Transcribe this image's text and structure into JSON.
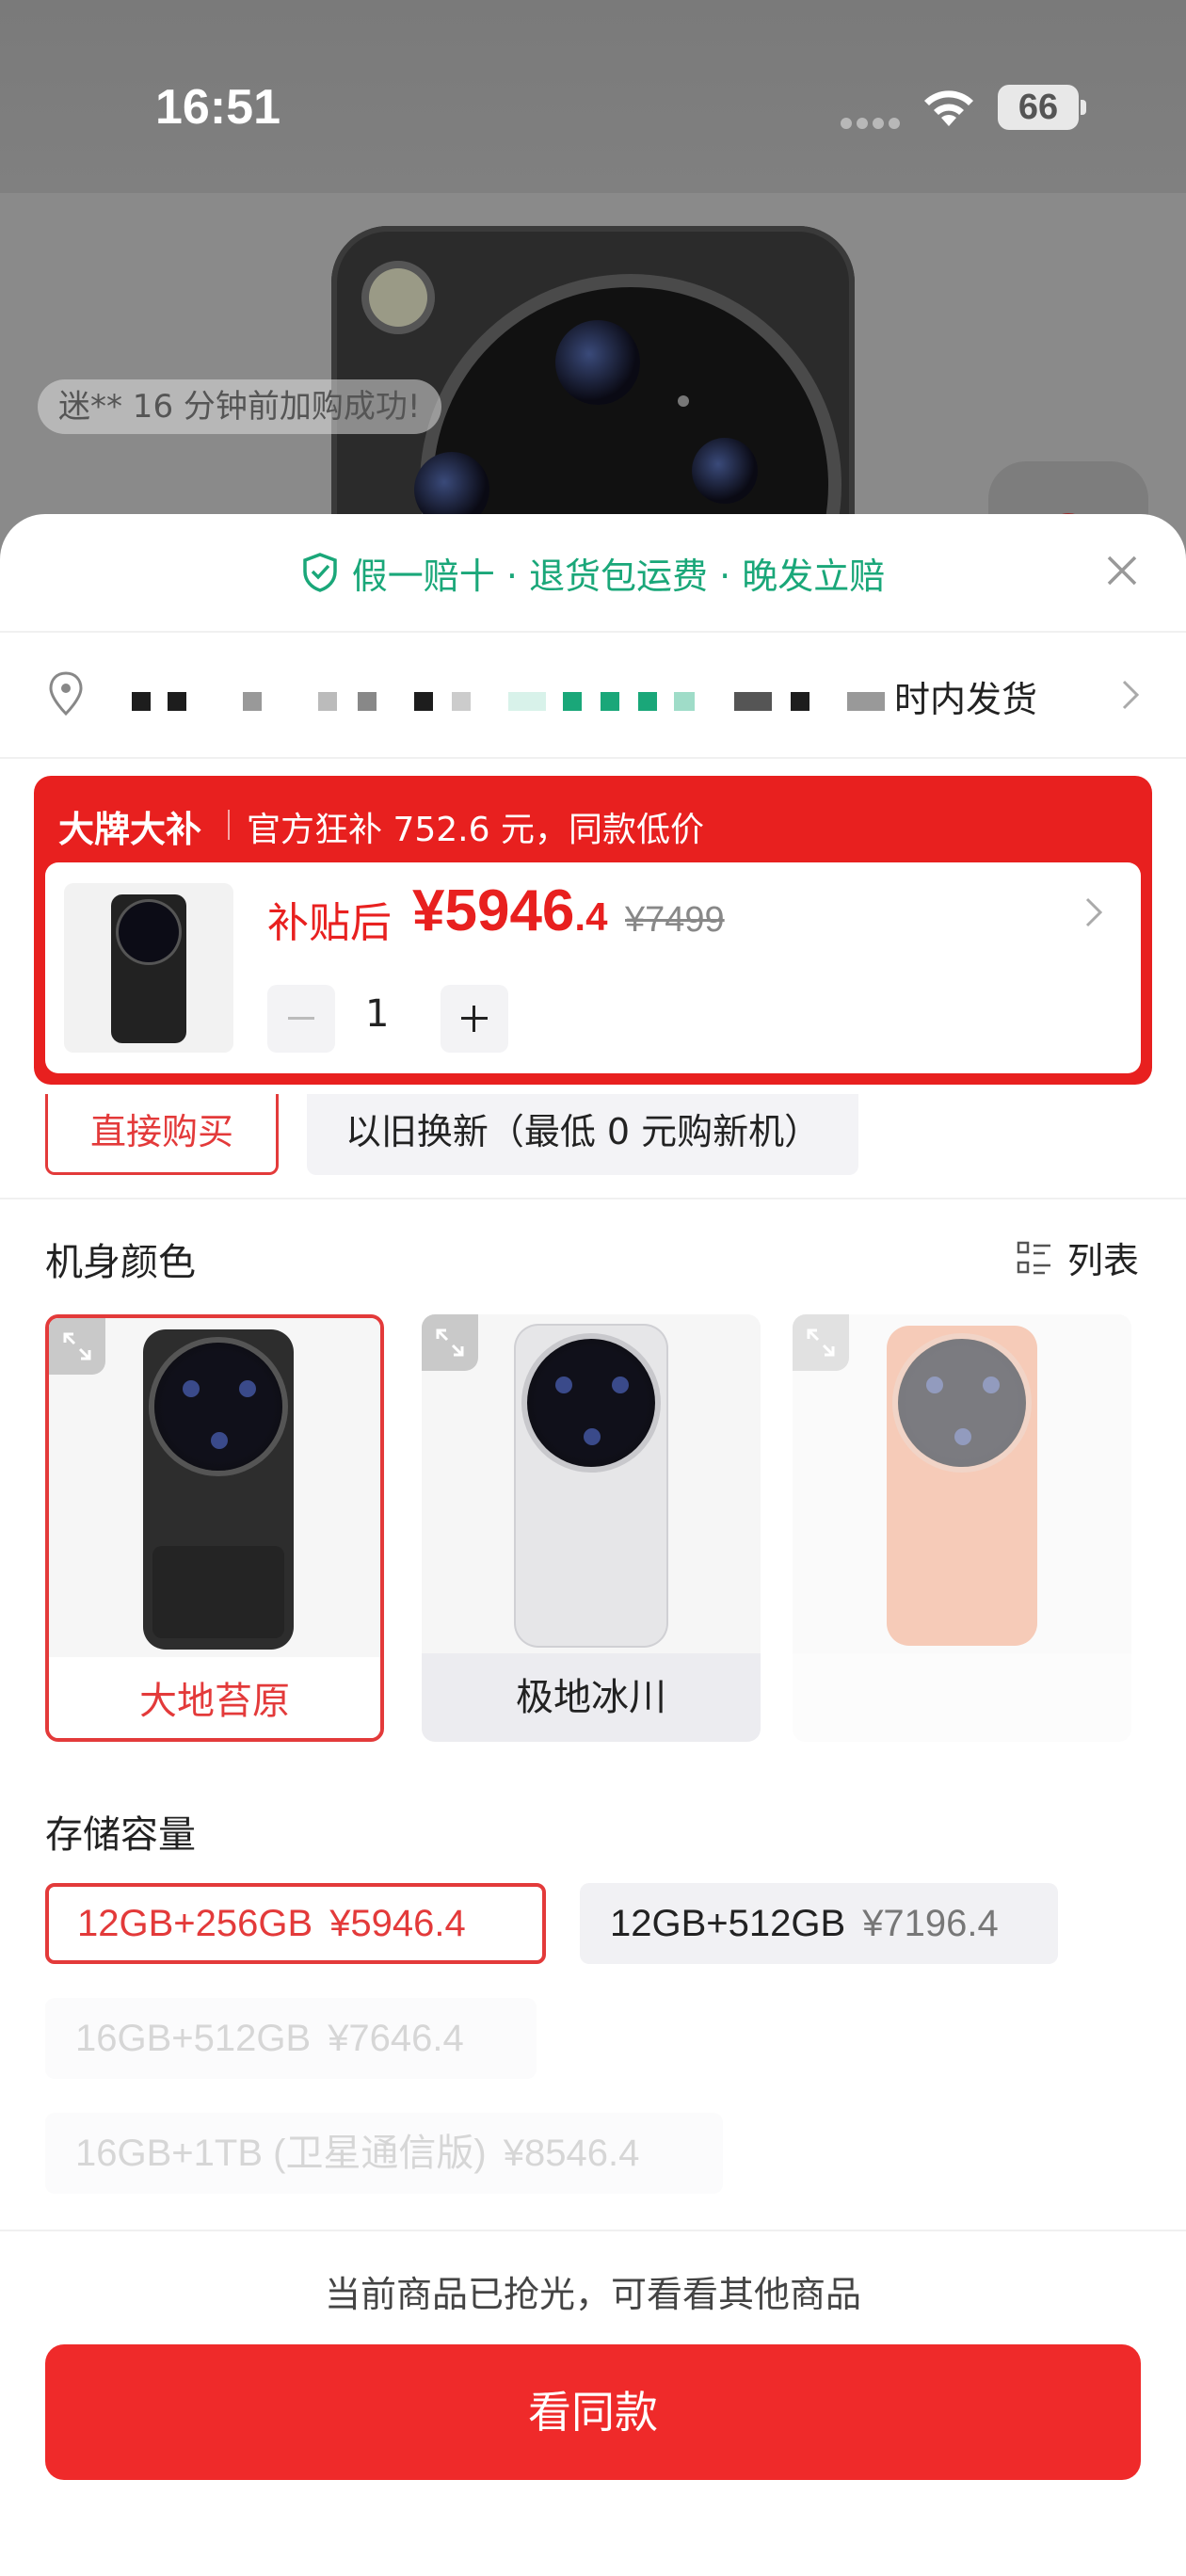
{
  "status_bar": {
    "time": "16:51",
    "battery": "66"
  },
  "background": {
    "toast": "迷** 16 分钟前加购成功!"
  },
  "sheet": {
    "guarantee": "假一赔十 · 退货包运费 · 晚发立赔",
    "address": {
      "shipping_text": "时内发货"
    },
    "promo": {
      "brand_label": "大牌大补",
      "subsidy_text": "官方狂补 752.6 元，同款低价",
      "after_subsidy_label": "补贴后",
      "price_main": "¥5946",
      "price_decimal": ".4",
      "original_price": "¥7499",
      "quantity": "1"
    },
    "purchase_modes": [
      {
        "label": "直接购买",
        "selected": true
      },
      {
        "label": "以旧换新（最低 0 元购新机）",
        "selected": false
      }
    ],
    "color_section": {
      "title": "机身颜色",
      "list_view_label": "列表",
      "options": [
        {
          "label": "大地苔原",
          "selected": true,
          "swatch": "#2a2a2a"
        },
        {
          "label": "极地冰川",
          "selected": false,
          "swatch": "#e4e4e6"
        },
        {
          "label": "",
          "selected": false,
          "swatch": "#f0a27f"
        }
      ]
    },
    "storage_section": {
      "title": "存储容量",
      "options": [
        {
          "spec": "12GB+256GB",
          "price": "¥5946.4",
          "state": "selected"
        },
        {
          "spec": "12GB+512GB",
          "price": "¥7196.4",
          "state": "available"
        },
        {
          "spec": "16GB+512GB",
          "price": "¥7646.4",
          "state": "disabled"
        },
        {
          "spec": "16GB+1TB (卫星通信版)",
          "price": "¥8546.4",
          "state": "disabled"
        }
      ]
    },
    "sold_out_text": "当前商品已抢光，可看看其他商品",
    "cta_label": "看同款"
  },
  "colors": {
    "accent": "#e8201f",
    "guarantee_green": "#1aa779"
  }
}
